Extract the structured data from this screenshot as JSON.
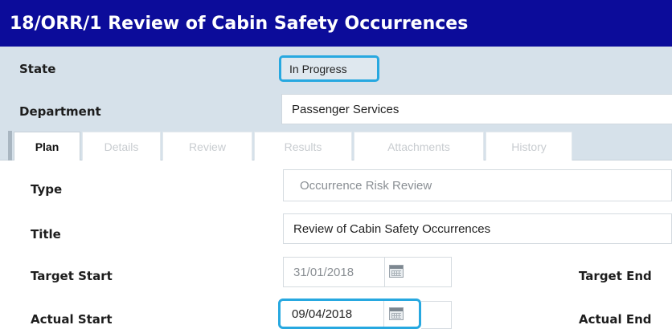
{
  "window": {
    "title": "18/ORR/1 Review of Cabin Safety Occurrences"
  },
  "header": {
    "state_label": "State",
    "state_value": "In Progress",
    "department_label": "Department",
    "department_value": "Passenger Services"
  },
  "tabs": [
    {
      "label": "Plan",
      "active": true
    },
    {
      "label": "Details",
      "active": false
    },
    {
      "label": "Review",
      "active": false
    },
    {
      "label": "Results",
      "active": false
    },
    {
      "label": "Attachments",
      "active": false
    },
    {
      "label": "History",
      "active": false
    }
  ],
  "form": {
    "type_label": "Type",
    "type_value": "Occurrence Risk Review",
    "title_label": "Title",
    "title_value": "Review of Cabin Safety Occurrences",
    "target_start_label": "Target Start",
    "target_start_value": "31/01/2018",
    "target_end_label": "Target End",
    "actual_start_label": "Actual Start",
    "actual_start_value": "09/04/2018",
    "actual_end_label": "Actual End"
  },
  "icons": {
    "calendar": "calendar-icon"
  },
  "colors": {
    "title_bar": "#0c0c9a",
    "panel": "#d6e1ea",
    "highlight": "#27a8e0"
  }
}
